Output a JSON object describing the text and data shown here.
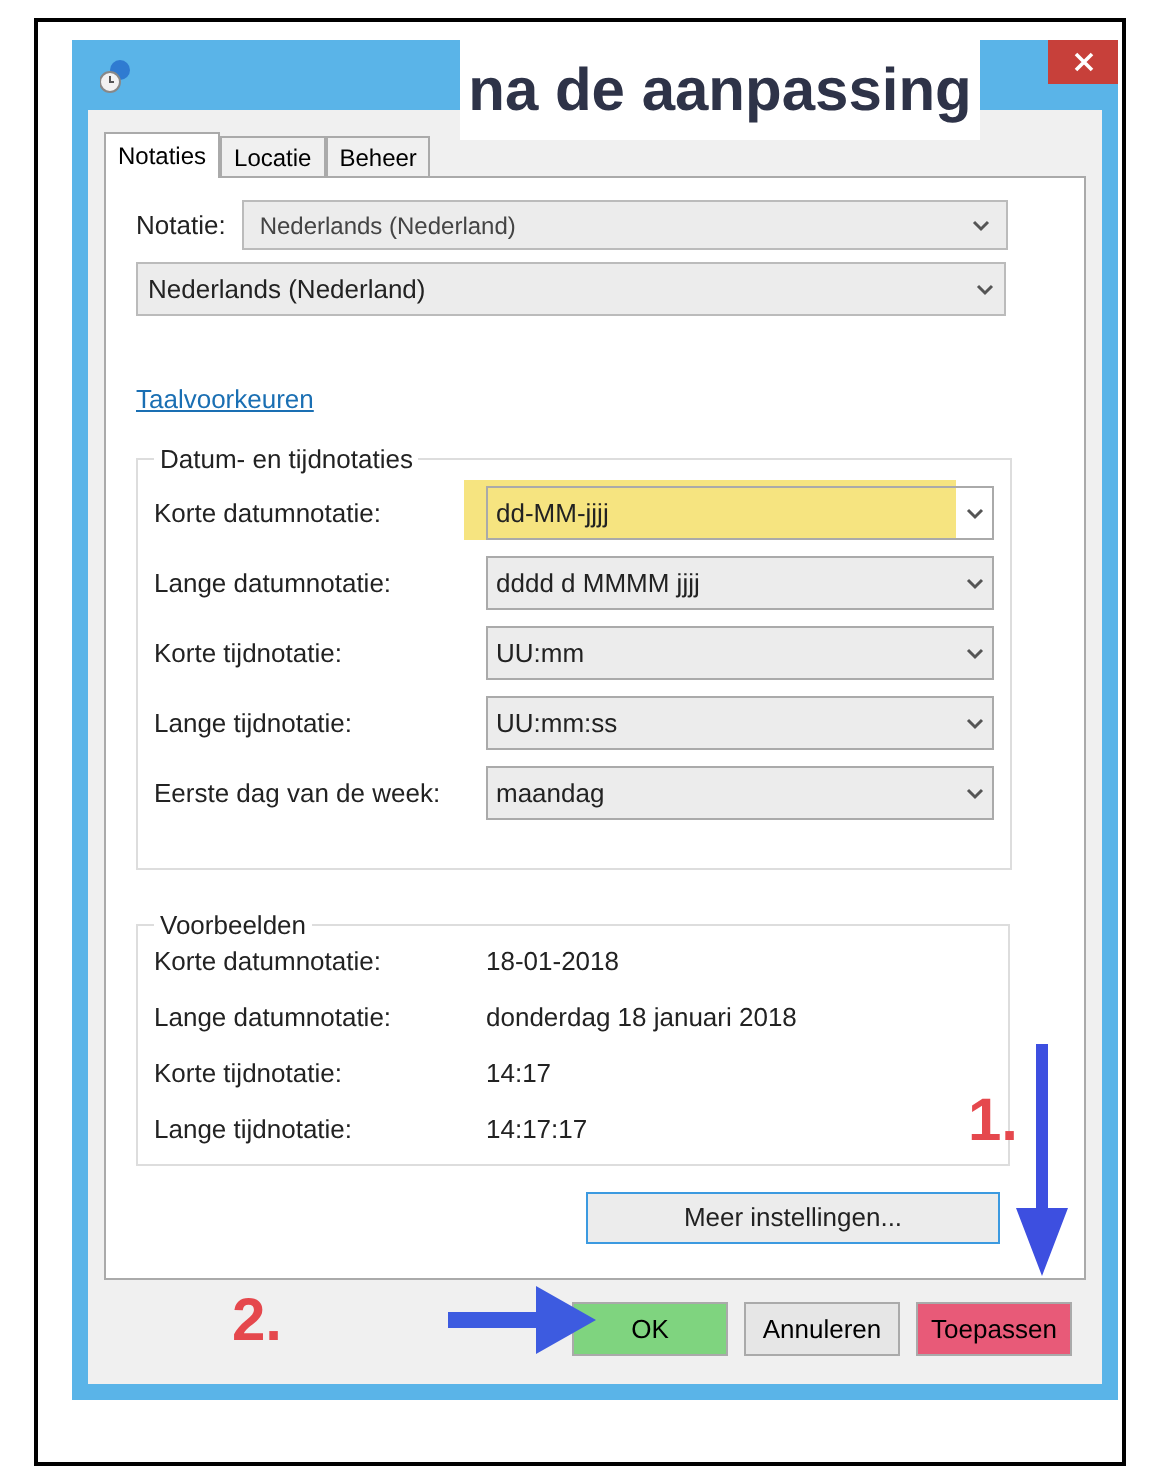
{
  "annotation_title": "na de aanpassing",
  "annotation_steps": [
    {
      "label": "1.",
      "kind": "down"
    },
    {
      "label": "2.",
      "kind": "right"
    }
  ],
  "tabs": [
    {
      "label": "Notaties",
      "selected": true
    },
    {
      "label": "Locatie",
      "selected": false
    },
    {
      "label": "Beheer",
      "selected": false
    }
  ],
  "notatie": {
    "label": "Notatie:",
    "value": "Nederlands (Nederland)"
  },
  "format_select": {
    "value": "Nederlands (Nederland)"
  },
  "link": "Taalvoorkeuren",
  "formats_group": {
    "title": "Datum- en tijdnotaties",
    "rows": [
      {
        "label": "Korte datumnotatie:",
        "value": "dd-MM-jjjj",
        "highlighted": true
      },
      {
        "label": "Lange datumnotatie:",
        "value": "dddd d MMMM jjjj",
        "highlighted": false
      },
      {
        "label": "Korte tijdnotatie:",
        "value": "UU:mm",
        "highlighted": false
      },
      {
        "label": "Lange tijdnotatie:",
        "value": "UU:mm:ss",
        "highlighted": false
      },
      {
        "label": "Eerste dag van de week:",
        "value": "maandag",
        "highlighted": false
      }
    ]
  },
  "examples_group": {
    "title": "Voorbeelden",
    "rows": [
      {
        "label": "Korte datumnotatie:",
        "value": "18-01-2018"
      },
      {
        "label": "Lange datumnotatie:",
        "value": "donderdag 18 januari 2018"
      },
      {
        "label": "Korte tijdnotatie:",
        "value": "14:17"
      },
      {
        "label": "Lange tijdnotatie:",
        "value": "14:17:17"
      }
    ]
  },
  "more_button": "Meer instellingen...",
  "buttons": [
    {
      "label": "OK",
      "color": "#7fd47f"
    },
    {
      "label": "Annuleren",
      "color": "#e6e6e6"
    },
    {
      "label": "Toepassen",
      "color": "#e85a78"
    }
  ]
}
